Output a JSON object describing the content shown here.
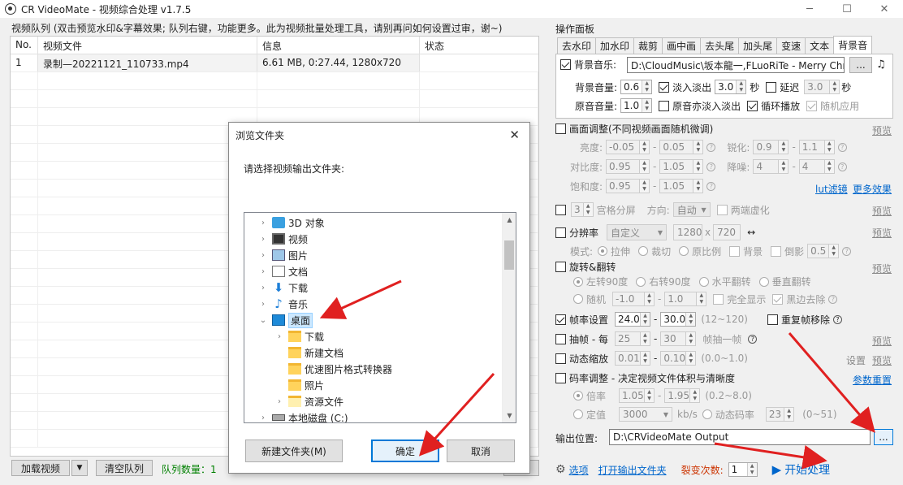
{
  "window": {
    "title": "CR VideoMate - 视频综合处理 v1.7.5"
  },
  "queue": {
    "label": "视频队列 (双击预览水印&字幕效果; 队列右键，功能更多。此为视频批量处理工具，请别再问如何设置过审，谢~)",
    "columns": [
      "No.",
      "视频文件",
      "信息",
      "状态"
    ],
    "rows": [
      {
        "no": "1",
        "file": "录制—20221121_110733.mp4",
        "info": "6.61 MB, 0:27.44, 1280x720",
        "status": ""
      }
    ],
    "load_button": "加载视频",
    "clear_button": "清空队列",
    "count_label": "队列数量：1"
  },
  "dialog": {
    "title": "浏览文件夹",
    "prompt": "请选择视频输出文件夹:",
    "tree": [
      "3D 对象",
      "视频",
      "图片",
      "文档",
      "下载",
      "音乐",
      "桌面",
      "下载",
      "新建文档",
      "优速图片格式转换器",
      "照片",
      "资源文件",
      "本地磁盘 (C:)"
    ],
    "new_folder_button": "新建文件夹(M)",
    "ok_button": "确定",
    "cancel_button": "取消"
  },
  "panel": {
    "title": "操作面板",
    "tabs": [
      "去水印",
      "加水印",
      "裁剪",
      "画中画",
      "去头尾",
      "加头尾",
      "变速",
      "文本",
      "背景音"
    ],
    "bgm": {
      "label": "背景音乐:",
      "path": "D:\\CloudMusic\\坂本龍一,FLuoRiTe - Merry Christ",
      "browse": "...",
      "volume_label": "背景音量:",
      "volume": "0.6",
      "fade_label": "淡入淡出",
      "fade": "3.0",
      "sec": "秒",
      "delay_label": "延迟",
      "delay": "3.0",
      "sec2": "秒",
      "orig_label": "原音音量:",
      "orig": "1.0",
      "orig_fade_label": "原音亦淡入淡出",
      "loop_label": "循环播放",
      "random_label": "随机应用"
    },
    "picture": {
      "label": "画面调整(不同视频画面随机微调)",
      "preview": "预览",
      "brightness_label": "亮度:",
      "b1": "-0.05",
      "b2": "0.05",
      "sharp_label": "锐化:",
      "s1": "0.9",
      "s2": "1.1",
      "contrast_label": "对比度:",
      "c1": "0.95",
      "c2": "1.05",
      "denoise_label": "降噪:",
      "d1": "4",
      "d2": "4",
      "saturation_label": "饱和度:",
      "sa1": "0.95",
      "sa2": "1.05",
      "lut": "lut滤镜",
      "more": "更多效果",
      "dash": "-"
    },
    "grid": {
      "num": "3",
      "label": "宫格分屏",
      "dir_label": "方向:",
      "dir": "自动",
      "blur_label": "两端虚化",
      "preview": "预览"
    },
    "resolution": {
      "label": "分辨率",
      "mode": "自定义",
      "w": "1280",
      "x": "x",
      "h": "720",
      "link": "↔",
      "preview": "预览",
      "mode_label": "模式:",
      "stretch": "拉伸",
      "crop": "裁切",
      "ratio": "原比例",
      "bg": "背景",
      "shadow": "倒影",
      "shadow_v": "0.5"
    },
    "rotate": {
      "label": "旋转&翻转",
      "preview": "预览",
      "l90": "左转90度",
      "r90": "右转90度",
      "hflip": "水平翻转",
      "vflip": "垂直翻转",
      "random": "随机",
      "r1": "-1.0",
      "r2": "1.0",
      "full": "完全显示",
      "blackedge": "黑边去除"
    },
    "fps": {
      "label": "帧率设置",
      "f1": "24.0",
      "f2": "30.0",
      "range": "(12~120)",
      "dedupe": "重复帧移除"
    },
    "extract": {
      "label": "抽帧 - 每",
      "e1": "25",
      "e2": "30",
      "unit": "帧抽一帧",
      "preview": "预览"
    },
    "zoom": {
      "label": "动态缩放",
      "z1": "0.01",
      "z2": "0.10",
      "range": "(0.0~1.0)",
      "settings": "设置",
      "preview": "预览"
    },
    "bitrate": {
      "label": "码率调整 - 决定视频文件体积与清晰度",
      "reset": "参数重置",
      "mult_label": "倍率",
      "m1": "1.05",
      "m2": "1.95",
      "mrange": "(0.2~8.0)",
      "fixed_label": "定值",
      "fixed": "3000",
      "unit": "kb/s",
      "dyn_label": "动态码率",
      "dyn": "23",
      "drange": "(0~51)"
    },
    "output": {
      "label": "输出位置:",
      "path": "D:\\CRVideoMate Output",
      "browse": "..."
    },
    "bottom": {
      "options": "选项",
      "open_folder": "打开输出文件夹",
      "fission_label": "裂变次数:",
      "fission": "1",
      "start": "开始处理"
    }
  },
  "colors": {
    "accent": "#0066cc",
    "arrow": "#e02020",
    "select": "#cce8ff",
    "count": "#008000"
  }
}
